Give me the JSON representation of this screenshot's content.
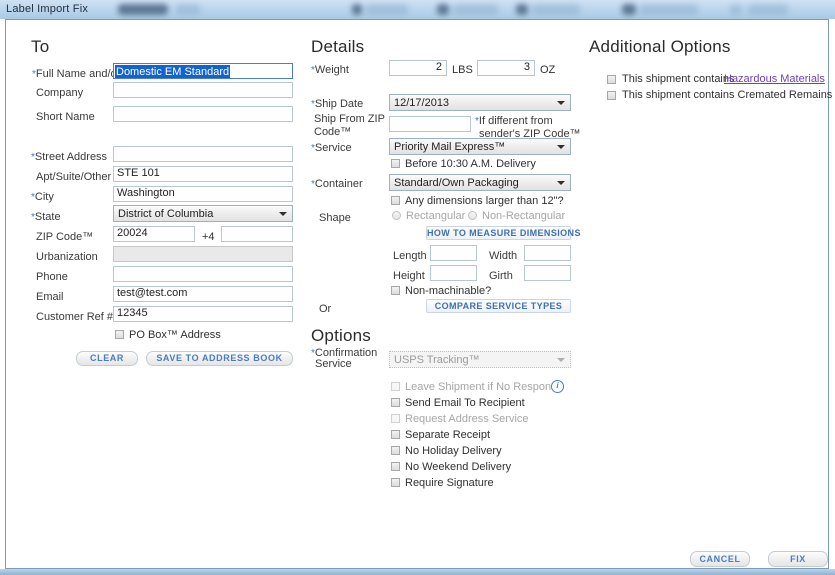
{
  "window": {
    "title": "Label Import Fix"
  },
  "to": {
    "heading": "To",
    "fields": {
      "full_name_label": "Full Name and/or",
      "full_name_value": "Domestic EM Standard",
      "company_label": "Company",
      "company_value": "",
      "short_name_label": "Short Name",
      "short_name_value": "",
      "street_label": "Street Address",
      "street_value": "",
      "apt_label": "Apt/Suite/Other",
      "apt_value": "STE 101",
      "city_label": "City",
      "city_value": "Washington",
      "state_label": "State",
      "state_value": "District of Columbia",
      "zip_label": "ZIP Code™",
      "zip_value": "20024",
      "zip4_label": "+4",
      "zip4_value": "",
      "urbanization_label": "Urbanization",
      "urbanization_value": "",
      "phone_label": "Phone",
      "phone_value": "",
      "email_label": "Email",
      "email_value": "test@test.com",
      "customer_ref_label": "Customer Ref #",
      "customer_ref_value": "12345"
    },
    "po_box_label": "PO Box™ Address",
    "clear_button": "CLEAR",
    "save_button": "SAVE TO ADDRESS BOOK"
  },
  "details": {
    "heading": "Details",
    "weight_label": "Weight",
    "weight_lbs": "2",
    "weight_lbs_unit": "LBS",
    "weight_oz": "3",
    "weight_oz_unit": "OZ",
    "ship_date_label": "Ship Date",
    "ship_date_value": "12/17/2013",
    "ship_from_zip_label": "Ship From ZIP Code™",
    "ship_from_zip_value": "",
    "ship_from_note_line1": "If different from",
    "ship_from_note_line2": "sender's ZIP Code™",
    "service_label": "Service",
    "service_value": "Priority Mail Express™",
    "before_1030_label": "Before 10:30 A.M. Delivery",
    "container_label": "Container",
    "container_value": "Standard/Own Packaging",
    "dimensions_over_12_label": "Any dimensions larger than 12\"?",
    "shape_label": "Shape",
    "shape_rectangular": "Rectangular",
    "shape_non_rectangular": "Non-Rectangular",
    "how_to_measure_button": "HOW TO MEASURE DIMENSIONS",
    "length_label": "Length",
    "length_value": "",
    "width_label": "Width",
    "width_value": "",
    "height_label": "Height",
    "height_value": "",
    "girth_label": "Girth",
    "girth_value": "",
    "non_machinable_label": "Non-machinable?",
    "or_label": "Or",
    "compare_service_button": "COMPARE SERVICE TYPES"
  },
  "options": {
    "heading": "Options",
    "confirmation_label_line1": "Confirmation",
    "confirmation_label_line2": "Service",
    "confirmation_value": "USPS Tracking™",
    "checkboxes": [
      {
        "label": "Leave Shipment if No Response",
        "disabled": true,
        "info": true
      },
      {
        "label": "Send Email To Recipient",
        "disabled": false,
        "info": false
      },
      {
        "label": "Request Address Service",
        "disabled": true,
        "info": false
      },
      {
        "label": "Separate Receipt",
        "disabled": false,
        "info": false
      },
      {
        "label": "No Holiday Delivery",
        "disabled": false,
        "info": false
      },
      {
        "label": "No Weekend Delivery",
        "disabled": false,
        "info": false
      },
      {
        "label": "Require Signature",
        "disabled": false,
        "info": false
      }
    ]
  },
  "additional_options": {
    "heading": "Additional Options",
    "hazmat_prefix": "This shipment contains",
    "hazmat_link": "Hazardous Materials",
    "cremated_label": "This shipment contains Cremated Remains"
  },
  "footer": {
    "cancel_button": "CANCEL",
    "fix_button": "FIX"
  },
  "colors": {
    "chrome": "#bcd6ee",
    "panel_border": "#7c9bb8",
    "link": "#7040b8",
    "button_text": "#4a7cc0",
    "selection": "#1263d2"
  }
}
